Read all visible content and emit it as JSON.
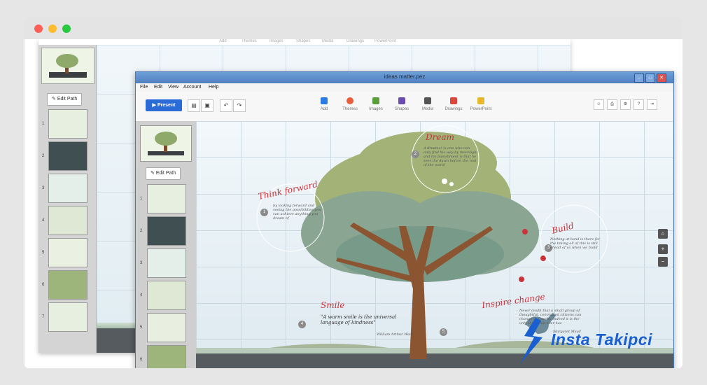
{
  "back_window": {
    "menu_items": [
      "Add",
      "Themes",
      "Images",
      "Shapes",
      "Media",
      "Drawings",
      "PowerPoint"
    ],
    "edit_path_label": "Edit Path",
    "slide_numbers": [
      "1",
      "2",
      "3",
      "4",
      "5",
      "6",
      "7"
    ]
  },
  "front_window": {
    "title": "ideas matter.pez",
    "window_buttons": [
      "–",
      "□",
      "✕"
    ],
    "menu": [
      "File",
      "Edit",
      "View",
      "Account",
      "Help"
    ],
    "present_label": "Present",
    "tools": [
      {
        "label": "Add",
        "icon": "add-icon",
        "color": "#2b7be0"
      },
      {
        "label": "Themes",
        "icon": "themes-icon",
        "color": "#e85d3a"
      },
      {
        "label": "Images",
        "icon": "images-icon",
        "color": "#5a9e3a"
      },
      {
        "label": "Shapes",
        "icon": "shapes-icon",
        "color": "#6a4bb0"
      },
      {
        "label": "Media",
        "icon": "media-icon",
        "color": "#555555"
      },
      {
        "label": "Drawings",
        "icon": "drawings-icon",
        "color": "#d9483b"
      },
      {
        "label": "PowerPoint",
        "icon": "powerpoint-icon",
        "color": "#e8b72a"
      }
    ],
    "edit_path_label": "Edit Path",
    "slide_numbers": [
      "1",
      "2",
      "3",
      "4",
      "5",
      "6"
    ],
    "canvas": {
      "think_forward": {
        "title": "Think forward",
        "number": "1",
        "text": "by looking forward and seeing the possibilities you can achieve anything you dream of"
      },
      "dream": {
        "title": "Dream",
        "number": "2",
        "text": "A dreamer is one who can only find his way by moonlight and his punishment is that he sees the dawn before the rest of the world"
      },
      "build": {
        "title": "Build",
        "number": "3",
        "text": "Nothing at hand is there for the taking all of this is still ahead of us when we build"
      },
      "smile": {
        "title": "Smile",
        "number": "4",
        "text": "\"A warm smile is the universal language of kindness\"",
        "author": "William Arthur Ward"
      },
      "inspire_change": {
        "title": "Inspire change",
        "number": "5",
        "text": "Never doubt that a small group of thoughtful, committed citizens can change the world. Indeed it is the only thing that ever has",
        "author": "Margaret Mead"
      }
    }
  },
  "watermark": {
    "text": "Insta Takipci"
  }
}
